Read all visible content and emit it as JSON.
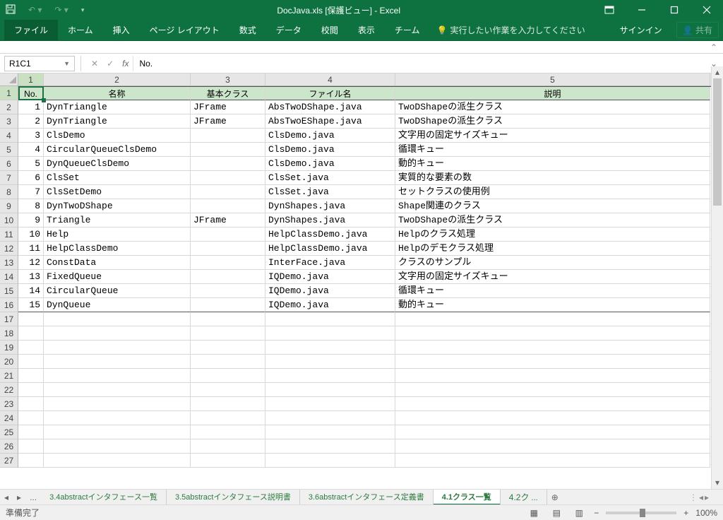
{
  "title": "DocJava.xls  [保護ビュー] - Excel",
  "ribbon": {
    "file": "ファイル",
    "home": "ホーム",
    "insert": "挿入",
    "layout": "ページ レイアウト",
    "formulas": "数式",
    "data": "データ",
    "review": "校閲",
    "view": "表示",
    "team": "チーム",
    "tellme": "実行したい作業を入力してください",
    "signin": "サインイン",
    "share": "共有"
  },
  "namebox": "R1C1",
  "formula": "No.",
  "colheaders": [
    "1",
    "2",
    "3",
    "4",
    "5"
  ],
  "rownums": [
    "1",
    "2",
    "3",
    "4",
    "5",
    "6",
    "7",
    "8",
    "9",
    "10",
    "11",
    "12",
    "13",
    "14",
    "15",
    "16",
    "17",
    "18",
    "19",
    "20",
    "21",
    "22",
    "23",
    "24",
    "25",
    "26",
    "27"
  ],
  "headers": {
    "no": "No.",
    "name": "名称",
    "base": "基本クラス",
    "file": "ファイル名",
    "desc": "説明"
  },
  "data": [
    {
      "no": "1",
      "name": "DynTriangle",
      "base": "JFrame",
      "file": "AbsTwoDShape.java",
      "desc": "TwoDShapeの派生クラス"
    },
    {
      "no": "2",
      "name": "DynTriangle",
      "base": "JFrame",
      "file": "AbsTwoEShape.java",
      "desc": "TwoDShapeの派生クラス"
    },
    {
      "no": "3",
      "name": "ClsDemo",
      "base": "",
      "file": "ClsDemo.java",
      "desc": "文字用の固定サイズキュー"
    },
    {
      "no": "4",
      "name": "CircularQueueClsDemo",
      "base": "",
      "file": "ClsDemo.java",
      "desc": "循環キュー"
    },
    {
      "no": "5",
      "name": "DynQueueClsDemo",
      "base": "",
      "file": "ClsDemo.java",
      "desc": "動的キュー"
    },
    {
      "no": "6",
      "name": "ClsSet",
      "base": "",
      "file": "ClsSet.java",
      "desc": "実質的な要素の数"
    },
    {
      "no": "7",
      "name": "ClsSetDemo",
      "base": "",
      "file": "ClsSet.java",
      "desc": "セットクラスの使用例"
    },
    {
      "no": "8",
      "name": "DynTwoDShape",
      "base": "",
      "file": "DynShapes.java",
      "desc": "Shape関連のクラス"
    },
    {
      "no": "9",
      "name": "Triangle",
      "base": "JFrame",
      "file": "DynShapes.java",
      "desc": "TwoDShapeの派生クラス"
    },
    {
      "no": "10",
      "name": "Help",
      "base": "",
      "file": "HelpClassDemo.java",
      "desc": "Helpのクラス処理"
    },
    {
      "no": "11",
      "name": "HelpClassDemo",
      "base": "",
      "file": "HelpClassDemo.java",
      "desc": "Helpのデモクラス処理"
    },
    {
      "no": "12",
      "name": "ConstData",
      "base": "",
      "file": "InterFace.java",
      "desc": "クラスのサンプル"
    },
    {
      "no": "13",
      "name": "FixedQueue",
      "base": "",
      "file": "IQDemo.java",
      "desc": "文字用の固定サイズキュー"
    },
    {
      "no": "14",
      "name": "CircularQueue",
      "base": "",
      "file": "IQDemo.java",
      "desc": "循環キュー"
    },
    {
      "no": "15",
      "name": "DynQueue",
      "base": "",
      "file": "IQDemo.java",
      "desc": "動的キュー"
    }
  ],
  "sheets": {
    "s1": "3.4abstractインタフェース一覧",
    "s2": "3.5abstractインタフェース説明書",
    "s3": "3.6abstractインタフェース定義書",
    "s4": "4.1クラス一覧",
    "s5": "4.2ク"
  },
  "status": "準備完了",
  "zoom": "100%"
}
